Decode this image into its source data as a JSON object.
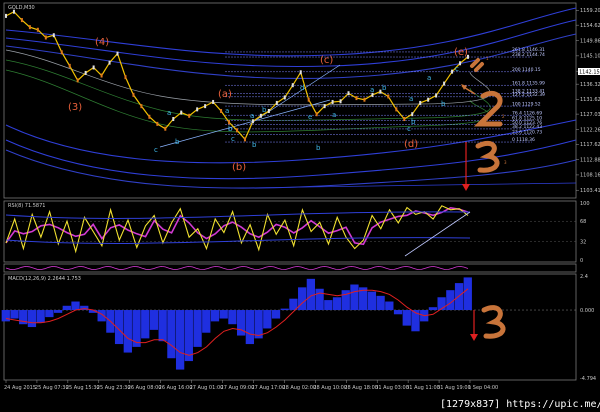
{
  "chart_data": [
    {
      "type": "line",
      "title": "GOLD,M30",
      "series": [
        {
          "values": [
            1157.5,
            1158.8,
            1156.2,
            1154.0,
            1153.2,
            1150.8,
            1151.5,
            1146.2,
            1142.0,
            1137.5,
            1139.8,
            1141.5,
            1139.0,
            1143.0,
            1145.8,
            1138.5,
            1133.0,
            1129.5,
            1126.2,
            1124.0,
            1122.5,
            1125.5,
            1127.5,
            1126.5,
            1128.5,
            1129.5,
            1130.8,
            1128.0,
            1124.5,
            1122.0,
            1119.2,
            1124.8,
            1126.5,
            1128.0,
            1130.5,
            1132.2,
            1136.0,
            1140.0,
            1131.5,
            1127.0,
            1129.5,
            1130.8,
            1131.0,
            1133.5,
            1132.0,
            1131.5,
            1133.0,
            1134.0,
            1132.5,
            1128.5,
            1125.5,
            1127.0,
            1130.5,
            1131.5,
            1132.8,
            1136.5,
            1140.2,
            1142.8,
            1144.8
          ]
        }
      ],
      "x_labels": [
        "24 Aug 2015",
        "25 Aug 07:30",
        "25 Aug 15:30",
        "25 Aug 23:30",
        "26 Aug 08:00",
        "26 Aug 16:00",
        "27 Aug 01:00",
        "27 Aug 09:00",
        "27 Aug 17:00",
        "28 Aug 02:00",
        "28 Aug 10:00",
        "28 Aug 18:00",
        "31 Aug 03:00",
        "31 Aug 11:00",
        "31 Aug 19:00",
        "1 Sep 04:00"
      ],
      "y_ticks": [
        1159.2,
        1154.62,
        1149.86,
        1145.1,
        1140.34,
        1136.32,
        1131.62,
        1127.03,
        1122.26,
        1117.62,
        1112.88,
        1108.16,
        1103.41
      ],
      "ylim": [
        1101.0,
        1161.5
      ],
      "price_label": "1142.15",
      "wave_labels": [
        "(3)",
        "(4)",
        "(a)",
        "(b)",
        "(c)",
        "(d)",
        "(e)"
      ],
      "sub_wave_labels": [
        "a",
        "b",
        "c",
        "d",
        "e"
      ],
      "fib_levels": [
        {
          "label": "261.8 1146.31",
          "value": 1146.31
        },
        {
          "label": "238.2 1144.74",
          "value": 1144.74
        },
        {
          "label": "200 1140.15",
          "value": 1140.15
        },
        {
          "label": "161.8 1135.99",
          "value": 1135.99
        },
        {
          "label": "138.2 1133.41",
          "value": 1133.41
        },
        {
          "label": "127.2 1132.39",
          "value": 1132.39
        },
        {
          "label": "100 1129.52",
          "value": 1129.52
        },
        {
          "label": "76.4 1126.69",
          "value": 1126.69
        },
        {
          "label": "61.8 1125.10",
          "value": 1125.1
        },
        {
          "label": "50.0 1123.76",
          "value": 1123.76
        },
        {
          "label": "38.2 1122.43",
          "value": 1122.43
        },
        {
          "label": "23.6 1120.73",
          "value": 1120.73
        },
        {
          "label": "0 1118.36",
          "value": 1118.36
        }
      ],
      "scenario_labels": [
        "1",
        "2",
        "3"
      ]
    },
    {
      "type": "line",
      "title": "RSI(8) 71.5871",
      "ylim": [
        0,
        100
      ],
      "y_ticks": [
        100,
        68,
        32,
        0
      ],
      "series": [
        {
          "values": [
            30,
            72,
            20,
            80,
            40,
            85,
            28,
            68,
            15,
            75,
            50,
            25,
            88,
            35,
            70,
            22,
            60,
            78,
            30,
            65,
            90,
            40,
            55,
            20,
            72,
            48,
            85,
            30,
            62,
            18,
            80,
            45,
            70,
            25,
            88,
            50,
            66,
            28,
            75,
            40,
            20,
            35,
            78,
            55,
            88,
            65,
            92,
            80,
            85,
            72,
            95,
            88,
            90,
            78
          ]
        }
      ]
    },
    {
      "type": "line",
      "title": "MACD(12,26,9) 2.2644 1.753",
      "ylim": [
        -4.794,
        2.4
      ],
      "y_ticks": [
        2.4,
        0.0,
        -4.794
      ],
      "series": [
        {
          "name": "histogram",
          "values": [
            -0.8,
            -0.6,
            -1.0,
            -1.2,
            -0.9,
            -0.5,
            -0.2,
            0.3,
            0.6,
            0.3,
            -0.2,
            -0.8,
            -1.6,
            -2.4,
            -3.0,
            -2.6,
            -2.0,
            -1.4,
            -2.2,
            -3.4,
            -4.2,
            -3.6,
            -2.6,
            -1.6,
            -0.8,
            -0.6,
            -1.0,
            -1.8,
            -2.4,
            -2.0,
            -1.3,
            -0.6,
            0.1,
            0.8,
            1.6,
            2.2,
            1.5,
            0.7,
            0.9,
            1.4,
            1.8,
            1.6,
            1.3,
            1.0,
            0.6,
            -0.3,
            -1.1,
            -1.5,
            -0.8,
            0.2,
            0.9,
            1.4,
            1.9,
            2.3
          ]
        },
        {
          "name": "signal",
          "values": [
            -0.6,
            -0.7,
            -0.8,
            -0.9,
            -0.9,
            -0.8,
            -0.6,
            -0.3,
            0.0,
            0.1,
            0.0,
            -0.3,
            -0.8,
            -1.4,
            -2.0,
            -2.3,
            -2.3,
            -2.1,
            -2.1,
            -2.5,
            -3.0,
            -3.2,
            -3.0,
            -2.6,
            -2.0,
            -1.5,
            -1.3,
            -1.4,
            -1.7,
            -1.8,
            -1.6,
            -1.2,
            -0.7,
            -0.1,
            0.5,
            1.0,
            1.2,
            1.1,
            1.0,
            1.1,
            1.3,
            1.4,
            1.4,
            1.3,
            1.1,
            0.7,
            0.2,
            -0.2,
            -0.4,
            -0.3,
            0.1,
            0.5,
            1.0,
            1.5
          ]
        }
      ]
    }
  ],
  "watermark": {
    "text": "[1279x837] https://upic.me/"
  }
}
